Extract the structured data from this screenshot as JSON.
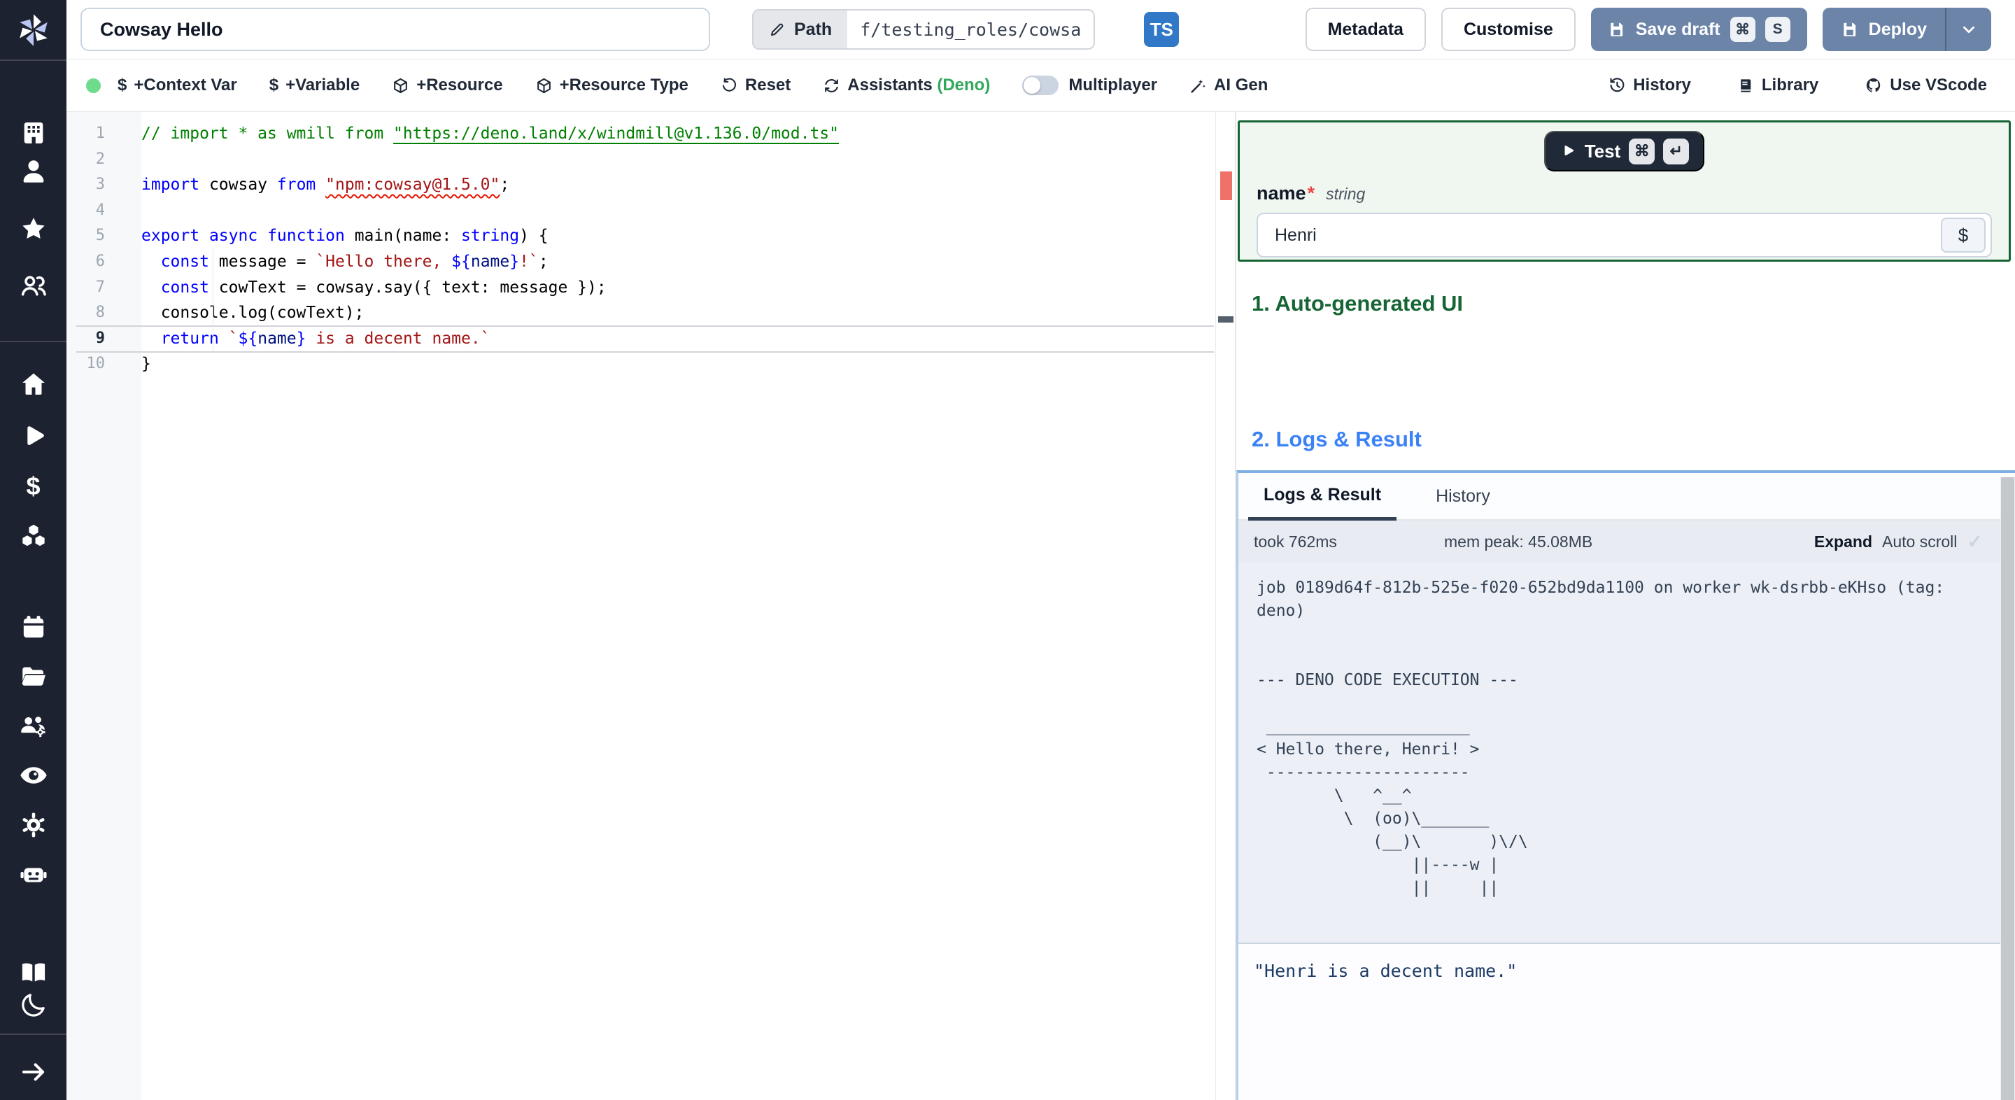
{
  "topbar": {
    "script_name": "Cowsay Hello",
    "path_label": "Path",
    "path_value": "f/testing_roles/cowsa",
    "lang_badge": "TS",
    "metadata_label": "Metadata",
    "customise_label": "Customise",
    "save_draft_label": "Save draft",
    "save_kbd_1": "⌘",
    "save_kbd_2": "S",
    "deploy_label": "Deploy"
  },
  "toolbar": {
    "dollar": "$",
    "context_var": "+Context Var",
    "variable": "+Variable",
    "resource": "+Resource",
    "resource_type": "+Resource Type",
    "reset": "Reset",
    "assistants": "Assistants",
    "assistants_lang": "(Deno)",
    "multiplayer": "Multiplayer",
    "ai_gen": "AI Gen",
    "history": "History",
    "library": "Library",
    "vscode": "Use VScode"
  },
  "sidebar": {
    "dollar_icon": "$",
    "icons": [
      "windmill-logo",
      "building",
      "user",
      "star",
      "user-group",
      "home",
      "play",
      "dollar",
      "cubes",
      "calendar",
      "folder-open",
      "users-gear",
      "eye",
      "gear",
      "robot",
      "book-open",
      "moon",
      "arrow-right"
    ]
  },
  "editor": {
    "lines": [
      {
        "n": "1",
        "active": false,
        "tokens": [
          [
            "// import * as wmill from ",
            "cmt"
          ],
          [
            "\"https://deno.land/x/windmill@v1.136.0/mod.ts\"",
            "cmtlink"
          ]
        ]
      },
      {
        "n": "2",
        "active": false,
        "tokens": []
      },
      {
        "n": "3",
        "active": false,
        "tokens": [
          [
            "import",
            "kw"
          ],
          [
            " cowsay ",
            "pln"
          ],
          [
            "from",
            "kw"
          ],
          [
            " ",
            "pln"
          ],
          [
            "\"npm:cowsay@1.5.0\"",
            "strerr"
          ],
          [
            ";",
            "pln"
          ]
        ]
      },
      {
        "n": "4",
        "active": false,
        "tokens": []
      },
      {
        "n": "5",
        "active": false,
        "tokens": [
          [
            "export",
            "kw"
          ],
          [
            " ",
            "pln"
          ],
          [
            "async",
            "kw"
          ],
          [
            " ",
            "pln"
          ],
          [
            "function",
            "kw"
          ],
          [
            " main(name: ",
            "pln"
          ],
          [
            "string",
            "kw"
          ],
          [
            ") {",
            "pln"
          ]
        ]
      },
      {
        "n": "6",
        "active": false,
        "tokens": [
          [
            "  ",
            "pln"
          ],
          [
            "const",
            "kw"
          ],
          [
            " message = ",
            "pln"
          ],
          [
            "`Hello there, ",
            "str"
          ],
          [
            "${",
            "tpl"
          ],
          [
            "name",
            "vr"
          ],
          [
            "}",
            "tpl"
          ],
          [
            "!`",
            "str"
          ],
          [
            ";",
            "pln"
          ]
        ]
      },
      {
        "n": "7",
        "active": false,
        "tokens": [
          [
            "  ",
            "pln"
          ],
          [
            "const",
            "kw"
          ],
          [
            " cowText = cowsay.say({ text: message });",
            "pln"
          ]
        ]
      },
      {
        "n": "8",
        "active": false,
        "tokens": [
          [
            "  console.log(cowText);",
            "pln"
          ]
        ]
      },
      {
        "n": "9",
        "active": true,
        "tokens": [
          [
            "  ",
            "pln"
          ],
          [
            "return",
            "kw"
          ],
          [
            " ",
            "pln"
          ],
          [
            "`",
            "str"
          ],
          [
            "${",
            "tpl"
          ],
          [
            "name",
            "vr"
          ],
          [
            "}",
            "tpl"
          ],
          [
            " is a decent name.`",
            "str"
          ]
        ]
      },
      {
        "n": "10",
        "active": false,
        "tokens": [
          [
            "}",
            "pln"
          ]
        ]
      }
    ]
  },
  "form": {
    "test_label": "Test",
    "test_kbd_1": "⌘",
    "test_kbd_2": "↵",
    "field_name": "name",
    "required_mark": "*",
    "field_type": "string",
    "field_value": "Henri",
    "var_picker": "$"
  },
  "sections": {
    "ui_heading": "1. Auto-generated UI",
    "logs_heading": "2. Logs & Result"
  },
  "logs": {
    "tabs": [
      "Logs & Result",
      "History"
    ],
    "took": "took 762ms",
    "mem": "mem peak: 45.08MB",
    "expand": "Expand",
    "autoscroll": "Auto scroll",
    "check": "✓",
    "content": "job 0189d64f-812b-525e-f020-652bd9da1100 on worker wk-dsrbb-eKHso (tag: deno)\n\n\n--- DENO CODE EXECUTION ---\n\n _____________________\n< Hello there, Henri! >\n ---------------------\n        \\   ^__^\n         \\  (oo)\\_______\n            (__)\\       )\\/\\\n                ||----w |\n                ||     ||",
    "result": "\"Henri is a decent name.\""
  },
  "colors": {
    "sidebar_bg": "#1d2230",
    "accent_green": "#166534",
    "heading_blue": "#3b82f6",
    "button_slate": "#6b84a8",
    "ts_badge_blue": "#3178c6",
    "status_dot_green": "#6fdb8c",
    "error_marker_red": "#f0716a",
    "deno_green": "#31a85c"
  }
}
